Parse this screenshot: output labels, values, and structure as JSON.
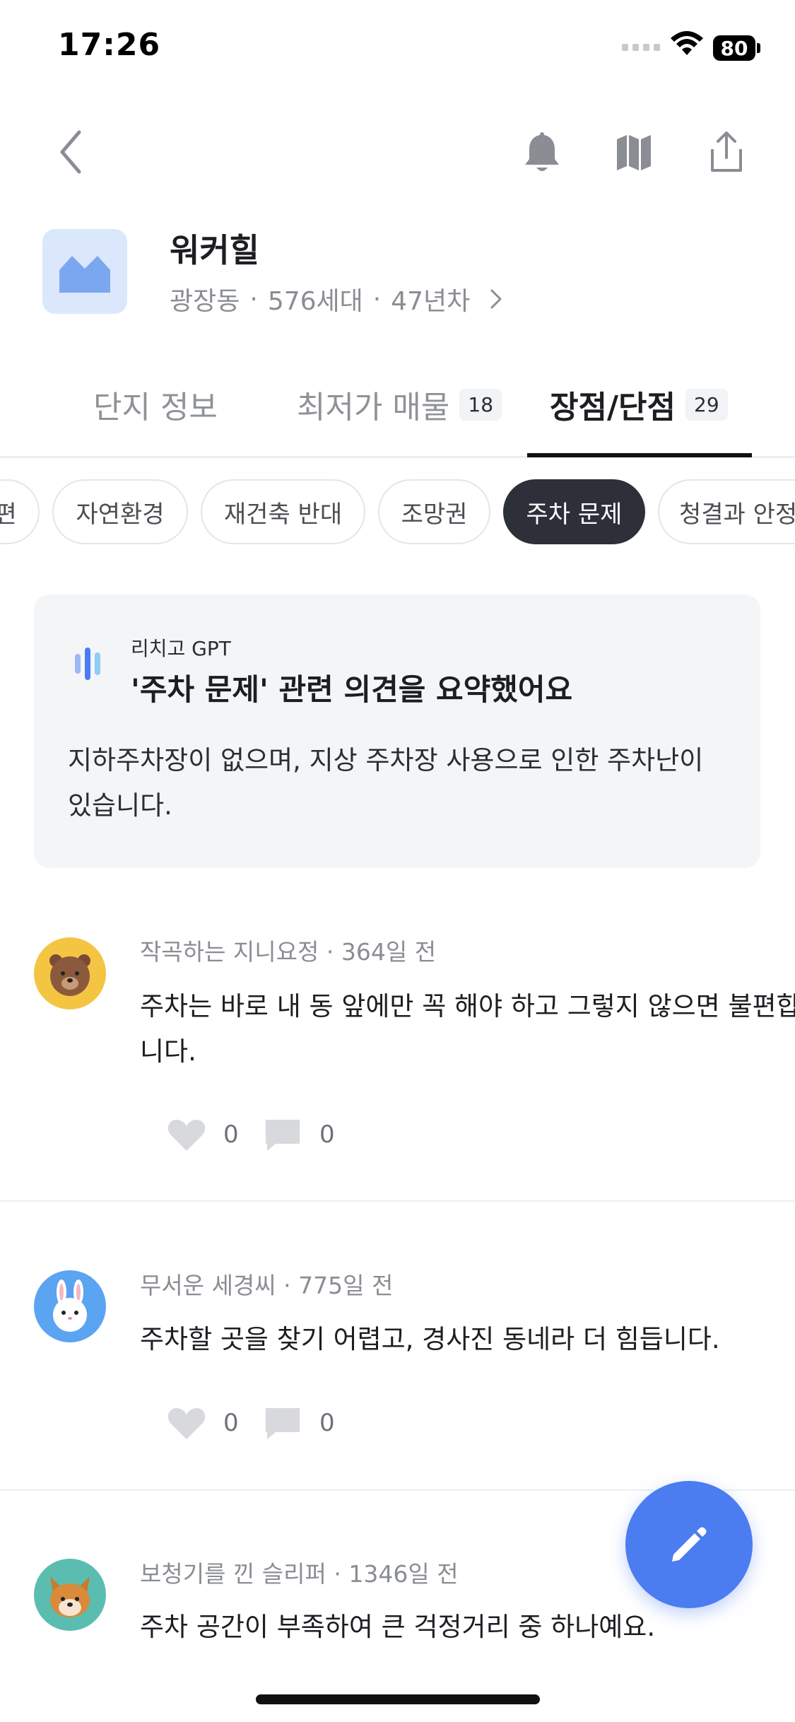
{
  "status_bar": {
    "time": "17:26",
    "battery": "80"
  },
  "complex": {
    "name": "워커힐",
    "location": "광장동",
    "households": "576세대",
    "age": "47년차"
  },
  "tabs": [
    {
      "label": "단지 정보",
      "count": ""
    },
    {
      "label": "최저가 매물",
      "count": "18"
    },
    {
      "label": "장점/단점",
      "count": "29"
    }
  ],
  "chips": [
    "편",
    "자연환경",
    "재건축 반대",
    "조망권",
    "주차 문제",
    "청결과 안정"
  ],
  "gpt_summary": {
    "source": "리치고 GPT",
    "title": "'주차 문제' 관련 의견을 요약했어요",
    "body": "지하주차장이 없으며, 지상 주차장 사용으로 인한 주차난이 있습니다."
  },
  "reviews": [
    {
      "author": "작곡하는 지니요정",
      "time": "364일 전",
      "text": "주차는 바로 내 동 앞에만 꼭 해야 하고 그렇지 않으면 불편합니다.",
      "likes": "0",
      "comments": "0"
    },
    {
      "author": "무서운 세경씨",
      "time": "775일 전",
      "text": "주차할 곳을 찾기 어렵고, 경사진 동네라 더 힘듭니다.",
      "likes": "0",
      "comments": "0"
    },
    {
      "author": "보청기를 낀 슬리퍼",
      "time": "1346일 전",
      "text": "주차 공간이 부족하여 큰 걱정거리 중 하나예요."
    }
  ],
  "colors": {
    "accent": "#4b7cf0",
    "chip_active": "#2d3038",
    "card_bg": "#f4f5f7"
  },
  "icons": [
    "back-arrow-icon",
    "bell-icon",
    "map-icon",
    "share-icon",
    "chevron-right-icon",
    "gpt-logo-icon",
    "heart-icon",
    "comment-icon",
    "pencil-icon"
  ]
}
